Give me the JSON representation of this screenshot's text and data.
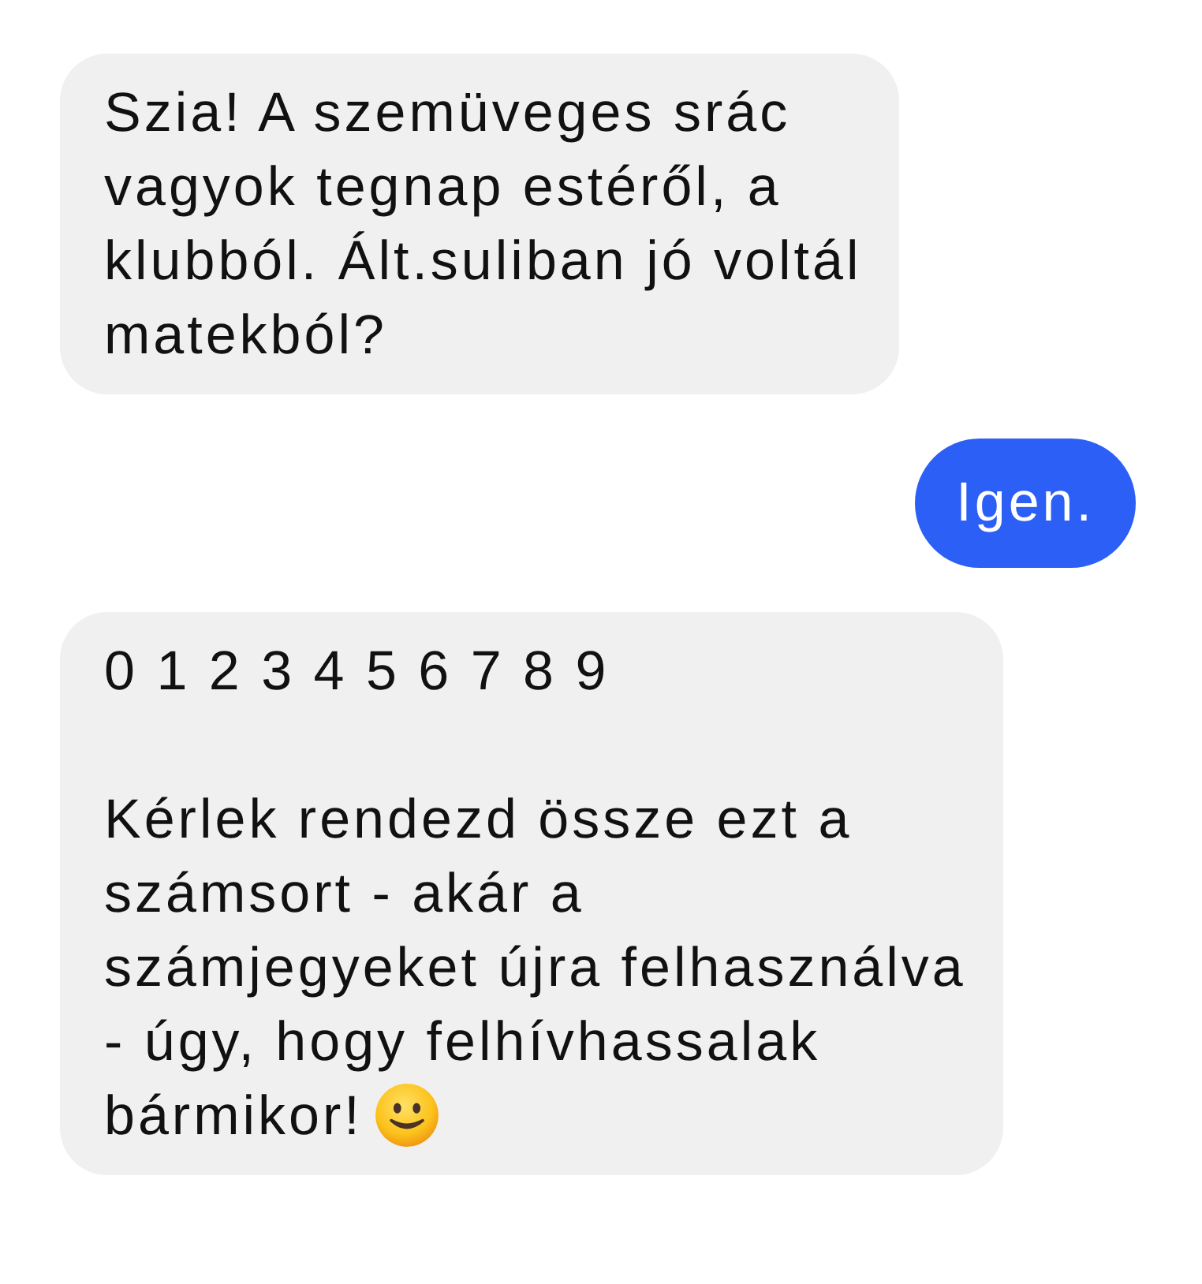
{
  "messages": [
    {
      "kind": "received",
      "paragraphs": [
        "Szia! A szemüveges srác\nvagyok tegnap estéről, a\nklubból. Ált.suliban jó voltál\nmatekból?"
      ],
      "emoji": false
    },
    {
      "kind": "sent",
      "paragraphs": [
        "Igen."
      ],
      "emoji": false
    },
    {
      "kind": "received",
      "paragraphs": [
        "0 1 2 3 4 5 6 7 8 9",
        "Kérlek rendezd össze ezt a\nszámsort - akár a\nszámjegyeket újra felhasználva\n- úgy, hogy felhívhassalak\nbármikor!"
      ],
      "emoji": true
    }
  ]
}
